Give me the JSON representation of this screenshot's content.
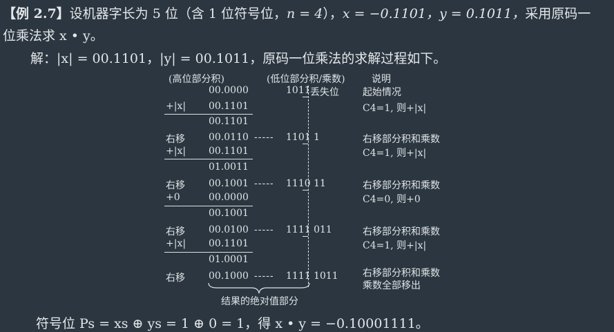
{
  "header": {
    "tag": "【例 2.7】",
    "intro": "设机器字长为 5 位（含 1 位符号位，",
    "n_expr": "n = 4",
    "mid": "），",
    "x_expr": "x = −0.1101，",
    "y_expr": "y = 0.1011，",
    "tail": "采用原码一",
    "line2": "位乘法求 x • y。"
  },
  "solution": {
    "lead": "解：",
    "absx": "|x| = 00.1101，",
    "absy": "|y| = 00.1011，",
    "rest": "原码一位乘法的求解过程如下。"
  },
  "table": {
    "col_high": "(高位部分积)",
    "col_low": "(低位部分积/乘数)",
    "col_note": "说明",
    "drop_label": "丢失位",
    "brace_label": "结果的绝对值部分",
    "rows": [
      {
        "op": "",
        "high": "00.0000",
        "low": "1011",
        "note": "起始情况"
      },
      {
        "op": "+|x|",
        "high": "00.1101",
        "low": "",
        "note": "C4=1, 则+|x|"
      },
      {
        "op": "",
        "high": "00.1101",
        "low": "",
        "note": ""
      },
      {
        "op": "右移",
        "high": "00.0110",
        "low": "1101 1",
        "note": "右移部分积和乘数"
      },
      {
        "op": "+|x|",
        "high": "00.1101",
        "low": "",
        "note": "C4=1, 则+|x|"
      },
      {
        "op": "",
        "high": "01.0011",
        "low": "",
        "note": ""
      },
      {
        "op": "右移",
        "high": "00.1001",
        "low": "1110 11",
        "note": "右移部分积和乘数"
      },
      {
        "op": "+0",
        "high": "00.0000",
        "low": "",
        "note": "C4=0, 则+0"
      },
      {
        "op": "",
        "high": "00.1001",
        "low": "",
        "note": ""
      },
      {
        "op": "右移",
        "high": "00.0100",
        "low": "1111 011",
        "note": "右移部分积和乘数"
      },
      {
        "op": "+|x|",
        "high": "00.1101",
        "low": "",
        "note": "C4=1, 则+|x|"
      },
      {
        "op": "",
        "high": "01.0001",
        "low": "",
        "note": ""
      },
      {
        "op": "右移",
        "high": "00.1000",
        "low": "1111 1011",
        "note": "右移部分积和乘数"
      },
      {
        "op": "",
        "high": "",
        "low": "",
        "note": "乘数全部移出"
      }
    ],
    "arrow": "-----"
  },
  "footer": {
    "text": "符号位 Ps = xs ⊕ ys = 1 ⊕ 0 = 1，得 x • y = −0.10001111。"
  }
}
